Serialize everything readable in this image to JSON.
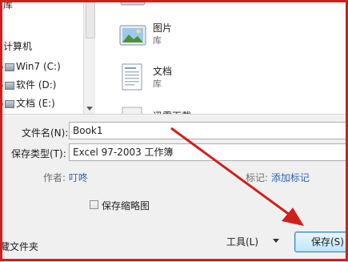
{
  "nav": {
    "items": [
      {
        "label": "库"
      },
      {
        "label": "计算机"
      },
      {
        "label": "Win7 (C:)"
      },
      {
        "label": "软件 (D:)"
      },
      {
        "label": "文档 (E:)"
      }
    ]
  },
  "files": [
    {
      "name": "图片",
      "type": "库",
      "icon": "picture-library-icon"
    },
    {
      "name": "文档",
      "type": "库",
      "icon": "document-library-icon"
    },
    {
      "name": "迅雷下载",
      "type": "",
      "icon": "folder-icon"
    }
  ],
  "form": {
    "filename_label": "文件名(N):",
    "filename_value": "Book1",
    "savetype_label": "保存类型(T):",
    "savetype_value": "Excel 97-2003 工作簿",
    "author_label": "作者:",
    "author_value": "叮咚",
    "tags_label": "标记:",
    "tags_value": "添加标记",
    "thumbnail_label": "保存缩略图",
    "hide_folders_label": "藏文件夹",
    "tools_label": "工具(L)",
    "save_label": "保存(S)"
  },
  "colors": {
    "annotation_red": "#d0201c",
    "link_blue": "#2e63b5"
  }
}
